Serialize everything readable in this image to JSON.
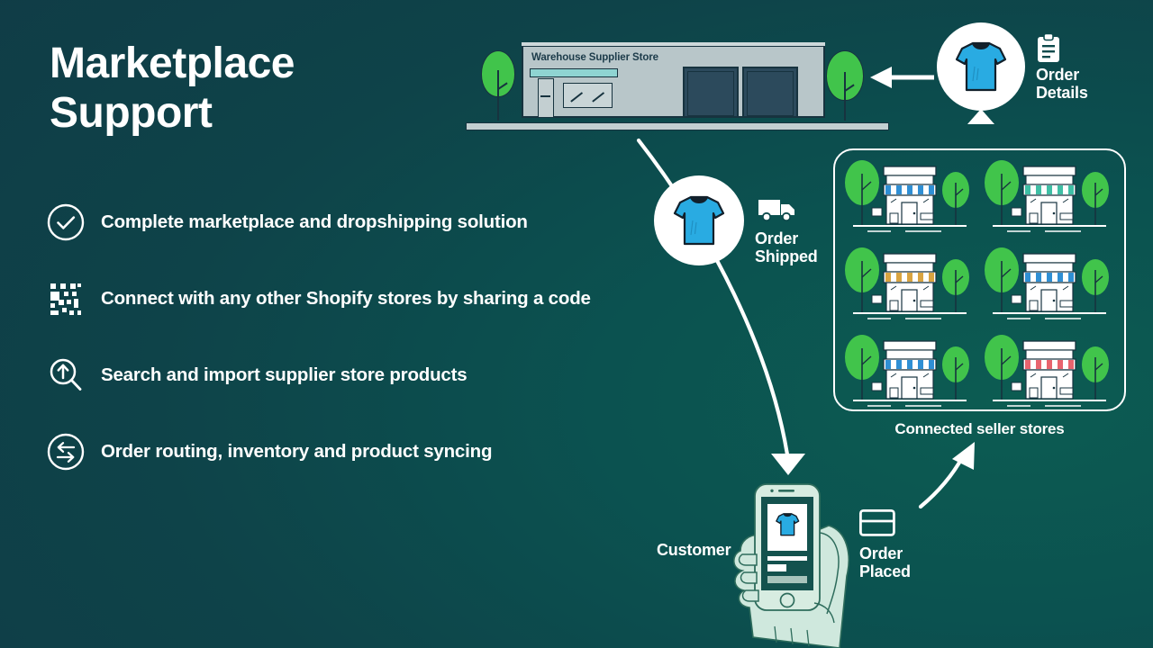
{
  "theme": {
    "bg_dark": "#103b46",
    "bg_green": "#0c5c52",
    "white": "#ffffff",
    "tshirt_blue": "#29abe2",
    "tree_green": "#41c44b",
    "outline_dark": "#17333f",
    "building_grey": "#b8c6c9"
  },
  "title": "Marketplace\nSupport",
  "features": [
    {
      "icon": "check-circle-icon",
      "label": "Complete marketplace and dropshipping solution"
    },
    {
      "icon": "qr-code-icon",
      "label": "Connect with any other Shopify stores by sharing a code"
    },
    {
      "icon": "search-import-icon",
      "label": "Search and import supplier store products"
    },
    {
      "icon": "sync-arrows-icon",
      "label": "Order routing, inventory and product syncing"
    }
  ],
  "warehouse": {
    "sign": "Warehouse Supplier Store",
    "bay_count": 2
  },
  "nodes": {
    "order_details": {
      "caption": "Order\nDetails",
      "icon": "clipboard-icon",
      "product_icon": "tshirt-icon"
    },
    "order_shipped": {
      "caption": "Order\nShipped",
      "icon": "truck-icon",
      "product_icon": "tshirt-icon"
    },
    "order_placed": {
      "caption": "Order\nPlaced",
      "icon": "credit-card-icon"
    }
  },
  "stores": {
    "caption": "Connected seller stores",
    "items": [
      {
        "awning_color": "#2f8fd4"
      },
      {
        "awning_color": "#3fbfa5"
      },
      {
        "awning_color": "#d9a441"
      },
      {
        "awning_color": "#2f8fd4"
      },
      {
        "awning_color": "#2f8fd4"
      },
      {
        "awning_color": "#e8646e"
      }
    ]
  },
  "customer": {
    "label": "Customer",
    "phone_product_icon": "tshirt-icon"
  }
}
